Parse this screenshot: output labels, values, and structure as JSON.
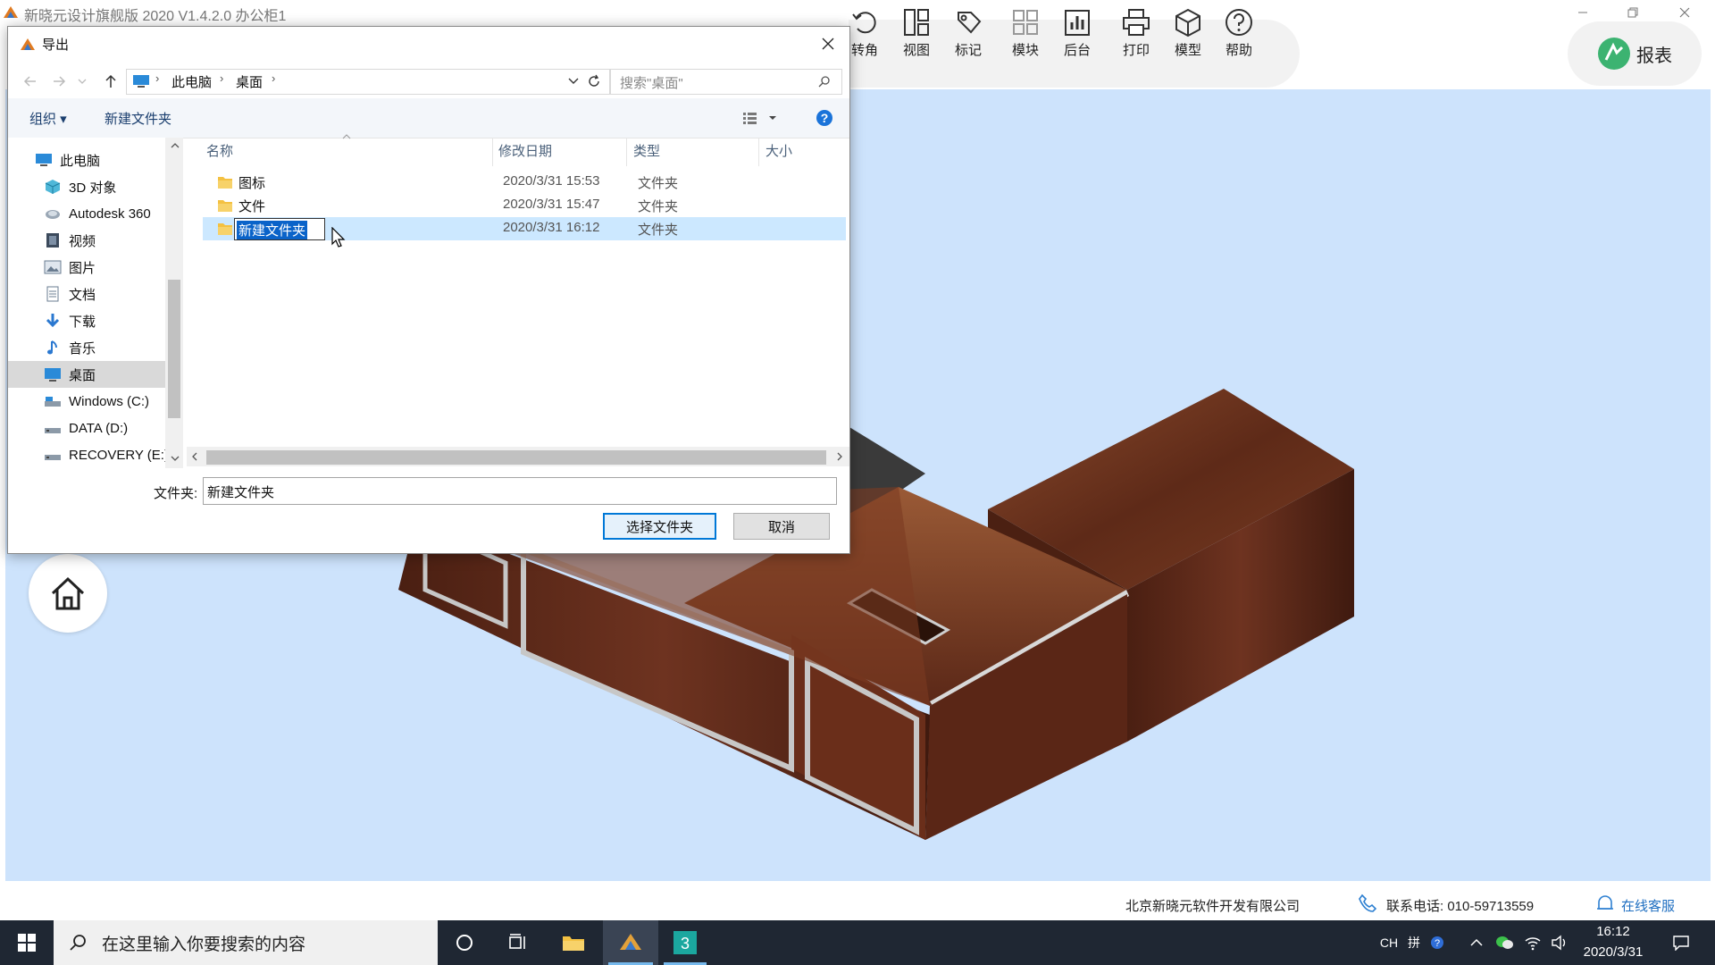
{
  "app": {
    "title": "新晓元设计旗舰版 2020 V1.4.2.0 办公柜1"
  },
  "toolbar": {
    "items": [
      {
        "label": "转角",
        "icon": "rotate-icon"
      },
      {
        "label": "视图",
        "icon": "layout-icon"
      },
      {
        "label": "标记",
        "icon": "tag-icon"
      },
      {
        "label": "模块",
        "icon": "grid-icon"
      },
      {
        "label": "后台",
        "icon": "bar-chart-icon"
      },
      {
        "label": "打印",
        "icon": "printer-icon"
      },
      {
        "label": "模型",
        "icon": "cube-icon"
      },
      {
        "label": "帮助",
        "icon": "help-icon"
      }
    ],
    "report_label": "报表"
  },
  "dialog": {
    "title": "导出",
    "breadcrumb": [
      "此电脑",
      "桌面"
    ],
    "search_placeholder": "搜索\"桌面\"",
    "organize_label": "组织 ▾",
    "new_folder_label": "新建文件夹",
    "nav_items": [
      {
        "label": "此电脑",
        "icon": "computer-icon"
      },
      {
        "label": "3D 对象",
        "icon": "3d-objects-icon"
      },
      {
        "label": "Autodesk 360",
        "icon": "cloud-icon"
      },
      {
        "label": "视频",
        "icon": "video-icon"
      },
      {
        "label": "图片",
        "icon": "pictures-icon"
      },
      {
        "label": "文档",
        "icon": "documents-icon"
      },
      {
        "label": "下载",
        "icon": "download-icon"
      },
      {
        "label": "音乐",
        "icon": "music-icon"
      },
      {
        "label": "桌面",
        "icon": "desktop-icon"
      },
      {
        "label": "Windows (C:)",
        "icon": "drive-icon"
      },
      {
        "label": "DATA (D:)",
        "icon": "drive-icon"
      },
      {
        "label": "RECOVERY (E:)",
        "icon": "drive-icon"
      }
    ],
    "columns": {
      "name": "名称",
      "date": "修改日期",
      "type": "类型",
      "size": "大小"
    },
    "files": [
      {
        "name": "图标",
        "date": "2020/3/31 15:53",
        "type": "文件夹"
      },
      {
        "name": "文件",
        "date": "2020/3/31 15:47",
        "type": "文件夹"
      },
      {
        "name": "新建文件夹",
        "date": "2020/3/31 16:12",
        "type": "文件夹"
      }
    ],
    "folder_label": "文件夹:",
    "folder_value": "新建文件夹",
    "select_button": "选择文件夹",
    "cancel_button": "取消"
  },
  "footer": {
    "company": "北京新晓元软件开发有限公司",
    "phone": "联系电话: 010-59713559",
    "support": "在线客服"
  },
  "taskbar": {
    "search_placeholder": "在这里输入你要搜索的内容",
    "ime_lang": "CH",
    "ime_mode": "拼",
    "time": "16:12",
    "date": "2020/3/31"
  }
}
